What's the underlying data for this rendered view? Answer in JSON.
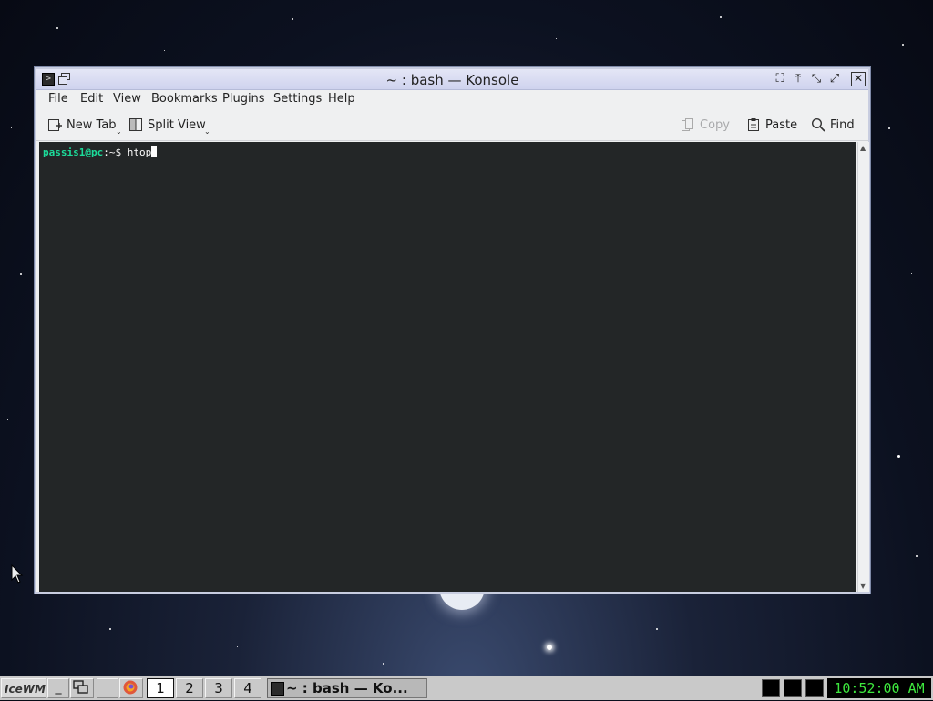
{
  "window": {
    "title": "~ : bash — Konsole",
    "buttons": [
      "maximize-icon",
      "layer-icon",
      "minimize-icon",
      "restore-icon",
      "close-icon"
    ]
  },
  "menu": {
    "items": [
      "File",
      "Edit",
      "View",
      "Bookmarks",
      "Plugins",
      "Settings",
      "Help"
    ]
  },
  "toolbar": {
    "new_tab": "New Tab",
    "split_view": "Split View",
    "copy": "Copy",
    "paste": "Paste",
    "find": "Find"
  },
  "terminal": {
    "user_host": "passis1@pc",
    "path_prompt": ":~$ ",
    "command": "htop",
    "colors": {
      "background": "#232627",
      "user": "#1cdc9a",
      "text": "#fcfcfc"
    }
  },
  "taskbar": {
    "start_label": "IceWM",
    "workspaces": [
      "1",
      "2",
      "3",
      "4"
    ],
    "active_workspace": "1",
    "task_label": "~ : bash — Ko...",
    "clock": "10:52:00 AM"
  }
}
